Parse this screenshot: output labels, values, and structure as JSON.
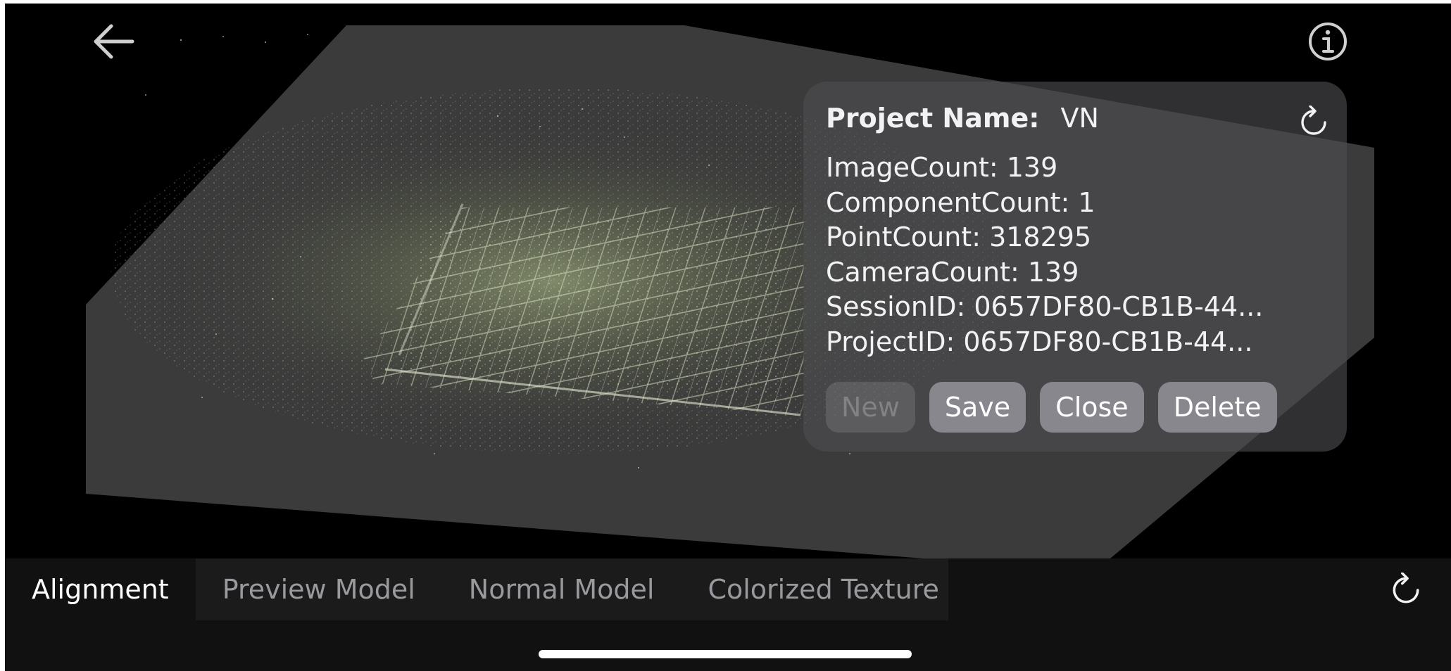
{
  "toolbar": {
    "back_icon": "arrow-left-icon",
    "info_icon": "info-circle-icon"
  },
  "project_panel": {
    "title_label": "Project Name:",
    "title_value": "VN",
    "refresh_icon": "refresh-icon",
    "stats": [
      "ImageCount: 139",
      "ComponentCount: 1",
      "PointCount: 318295",
      "CameraCount: 139",
      "SessionID: 0657DF80-CB1B-44...",
      "ProjectID: 0657DF80-CB1B-44..."
    ],
    "buttons": {
      "new": "New",
      "save": "Save",
      "close": "Close",
      "delete": "Delete"
    }
  },
  "tabs": [
    {
      "label": "Alignment",
      "active": true
    },
    {
      "label": "Preview Model",
      "active": false
    },
    {
      "label": "Normal Model",
      "active": false
    },
    {
      "label": "Colorized Texture",
      "active": false
    }
  ],
  "tab_bar": {
    "refresh_icon": "refresh-icon"
  },
  "colors": {
    "panel_bg": "#4e4e50",
    "button_bg": "#88878d",
    "tab_active_text": "#ffffff",
    "tab_inactive_text": "#9a9a9e",
    "point_cloud_tint": "#c7d9a0"
  }
}
